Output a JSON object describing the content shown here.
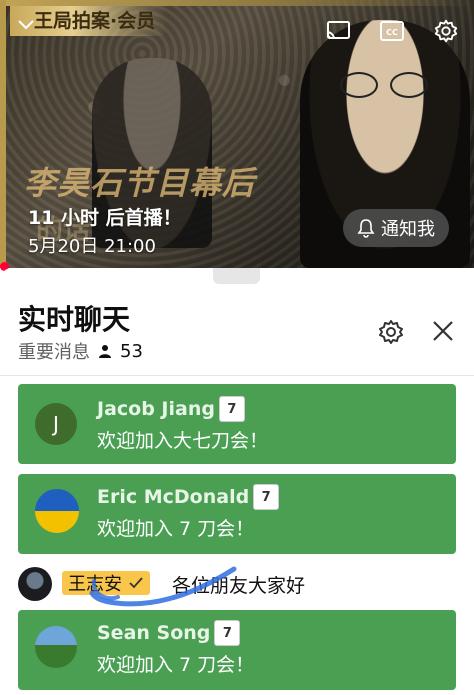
{
  "video": {
    "channel_badge": "王局拍案·会员",
    "show_title": "李昊石节目幕后",
    "title_shadow": "的话",
    "premiere_text": "11 小时 后首播！",
    "date_text": "5月20日 21:00",
    "notify_label": "通知我",
    "icons": [
      "chevron-down-icon",
      "cast-icon",
      "captions-icon",
      "gear-icon",
      "bell-icon"
    ]
  },
  "chat": {
    "title": "实时聊天",
    "filter_label": "重要消息",
    "viewer_count": "53",
    "messages": [
      {
        "type": "membership",
        "avatar_letter": "J",
        "author": "Jacob Jiang",
        "text": "欢迎加入大七刀会！"
      },
      {
        "type": "membership",
        "author": "Eric McDonald",
        "text": "欢迎加入 7 刀会！"
      },
      {
        "type": "chat",
        "author": "王志安",
        "text": "各位朋友大家好"
      },
      {
        "type": "membership",
        "author": "Sean Song",
        "text": "欢迎加入 7 刀会！"
      }
    ]
  },
  "colors": {
    "membership_green": "#4a9f53",
    "owner_badge": "#f9c54b",
    "live_red": "#ff0033"
  }
}
